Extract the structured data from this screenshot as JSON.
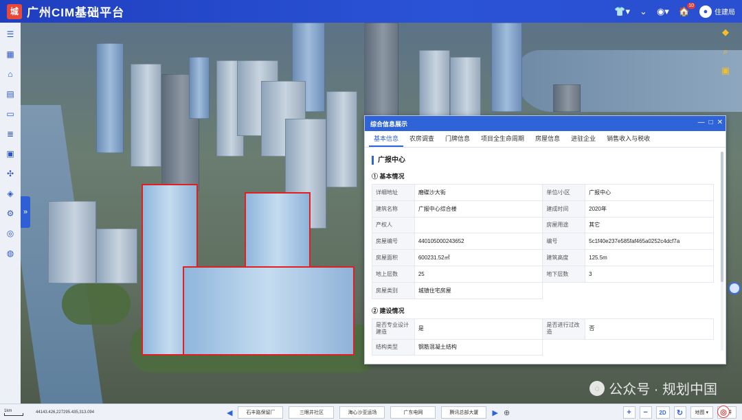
{
  "app": {
    "title": "广州CIM基础平台",
    "logo_glyph": "城"
  },
  "header": {
    "icons": [
      {
        "name": "theme-icon",
        "glyph": "👕▾"
      },
      {
        "name": "collapse-icon",
        "glyph": "⌄"
      },
      {
        "name": "location-icon",
        "glyph": "◉▾"
      },
      {
        "name": "notification-icon",
        "glyph": "🏠"
      }
    ],
    "notification_badge": "10",
    "user_name": "住建局"
  },
  "sidebar": {
    "items": [
      {
        "name": "menu-icon",
        "glyph": "☰"
      },
      {
        "name": "grid-icon",
        "glyph": "▦"
      },
      {
        "name": "home-icon",
        "glyph": "⌂"
      },
      {
        "name": "document-icon",
        "glyph": "▤"
      },
      {
        "name": "chat-icon",
        "glyph": "▭"
      },
      {
        "name": "list-icon",
        "glyph": "≣"
      },
      {
        "name": "data-icon",
        "glyph": "▣"
      },
      {
        "name": "network-icon",
        "glyph": "✣"
      },
      {
        "name": "analysis-icon",
        "glyph": "◈"
      },
      {
        "name": "settings-icon",
        "glyph": "⚙"
      },
      {
        "name": "target-icon",
        "glyph": "◎"
      },
      {
        "name": "globe-icon",
        "glyph": "◍"
      }
    ],
    "expand_glyph": "»"
  },
  "map_tools": [
    {
      "name": "layers-icon",
      "glyph": "◆"
    },
    {
      "name": "search-icon",
      "glyph": "⌕"
    },
    {
      "name": "toolbox-icon",
      "glyph": "▣"
    }
  ],
  "watermark": {
    "text": "公众号 · 规划中国",
    "icon": "◌"
  },
  "panel": {
    "title": "综合信息展示",
    "controls": [
      "—",
      "□",
      "✕"
    ],
    "tabs": [
      "基本信息",
      "农房调查",
      "门牌信息",
      "项目全生命周期",
      "房屋信息",
      "进驻企业",
      "销售收入与税收"
    ],
    "active_tab": 0,
    "building_name": "广报中心",
    "section1_title": "① 基本情况",
    "basic_rows": [
      [
        "详细地址",
        "磨碟沙大街",
        "单位/小区",
        "广报中心"
      ],
      [
        "建筑名称",
        "广报中心综合楼",
        "建成时间",
        "2020年"
      ],
      [
        "产权人",
        "",
        "房屋用途",
        "其它"
      ],
      [
        "房屋编号",
        "440105000243652",
        "编号",
        "5c1f40e237e585faf465a0252c4dcf7a"
      ],
      [
        "房屋面积",
        "600231.52㎡",
        "建筑高度",
        "125.5m"
      ],
      [
        "地上层数",
        "25",
        "地下层数",
        "3"
      ]
    ],
    "basic_last_row": [
      "房屋类别",
      "城镇住宅房屋"
    ],
    "section2_title": "② 建设情况",
    "build_rows": [
      [
        "是否专业设计建造",
        "是",
        "是否进行过改造",
        "否"
      ]
    ],
    "build_last_row": [
      "结构类型",
      "钢筋混凝土结构"
    ]
  },
  "bottombar": {
    "scale_label": "1km",
    "coords": "44143.426,227295.435,313.094",
    "prev_glyph": "◀",
    "next_glyph": "▶",
    "add_glyph": "⊕",
    "bookmarks": [
      "石丰路保留厂",
      "三眼井社区",
      "海心沙亚运场",
      "广东电网",
      "腾讯总部大厦"
    ],
    "tools": [
      {
        "name": "compass-icon",
        "glyph": "◎"
      },
      {
        "name": "zoom-in-icon",
        "glyph": "+"
      },
      {
        "name": "zoom-out-icon",
        "glyph": "−"
      },
      {
        "name": "2d-toggle",
        "glyph": "2D"
      },
      {
        "name": "refresh-icon",
        "glyph": "↻"
      }
    ],
    "basemap_select": "地图 ▾",
    "fullscreen_label": "全屏"
  }
}
